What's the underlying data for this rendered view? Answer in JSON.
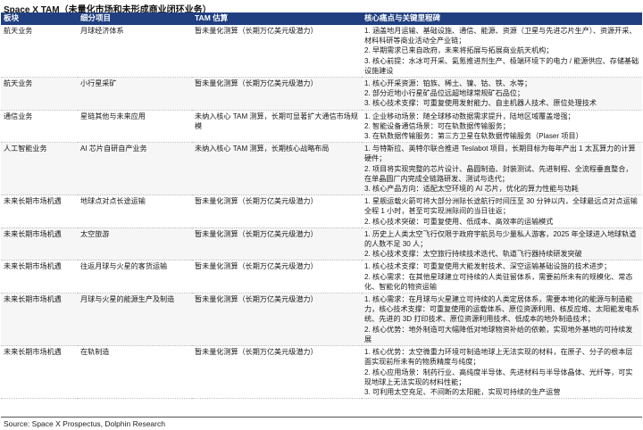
{
  "title": "Space X TAM（未量化市场和未形成商业闭环业务）",
  "headers": [
    "板块",
    "细分项目",
    "TAM 估算",
    "核心痛点与关键里程碑"
  ],
  "rows": [
    {
      "sector": "航天业务",
      "item": "月球经济体系",
      "tam": "暂未量化测算（长期万亿美元级潜力）",
      "milestones": [
        "1. 涵盖地月运输、基础设施、通信、能源、资源（卫星与先进芯片生产）、资源开采、材料科研等商业活动全产业链；",
        "2. 早期需求已来自政府，未来将拓展与拓展商业航天机构；",
        "3. 核心前提：水冰可开采、氦氪推进剂生产、极端环境下的电力 / 能源供应、存储基础设施建设"
      ]
    },
    {
      "sector": "航天业务",
      "item": "小行星采矿",
      "tam": "暂未量化测算（长期万亿美元级潜力）",
      "milestones": [
        "1. 核心开采资源：铂族、稀土、镍、钴、铁、水等；",
        "2. 部分近地小行星矿品位远超地球常规矿石品位；",
        "3. 核心技术支撑：可重复使用发射能力、自主机器人技术、原位处理技术"
      ]
    },
    {
      "sector": "通信业务",
      "item": "星链其他与未来应用",
      "tam": "未纳入核心 TAM 测算，长期可显著扩大通信市场规模",
      "milestones": [
        "1. 企业移动场景：随全球移动数据需求提升，陆地区域覆盖增强；",
        "2. 智能设备通信场景：可在轨数据传输服务；",
        "3. 在轨数据传输服务：第三方卫星在轨数据传输服务（Plaser 项目）"
      ]
    },
    {
      "sector": "人工智能业务",
      "item": "AI 芯片自研自产业务",
      "tam": "未纳入核心 TAM 测算，长期核心战略布局",
      "milestones": [
        "1. 与特斯拉、英特尔联合推进 Teslabot 项目，长期目标为每年产出 1 太瓦算力的计算硬件；",
        "2. 项目将实现完整的芯片设计、晶圆制造、封装测试、先进制程、全流程垂直整合，在单晶圆厂内完成全链路研发、测试与迭代；",
        "3. 核心产品方向：适配太空环境的 AI 芯片，优化的算力性能与功耗"
      ]
    },
    {
      "sector": "未来长期市场机遇",
      "item": "地球点对点长途运输",
      "tam": "暂未量化测算（长期万亿美元级潜力）",
      "milestones": [
        "1. 星舰运载火箭可将大部分洲际长途航行时间压至 30 分钟以内，全球最远点对点运输全程 1 小时，甚至可实现洲际间的当日往返；",
        "2. 核心技术突破：可重复使用、低成本、高效率的运输模式"
      ]
    },
    {
      "sector": "未来长期市场机遇",
      "item": "太空旅游",
      "tam": "暂未量化测算（长期万亿美元级潜力）",
      "milestones": [
        "1. 历史上人类太空飞行仅限于政府宇航员与少量私人游客，2025 年全球进入地球轨道的人数不足 30 人；",
        "2. 核心技术支撑：太空旅行持续技术迭代、轨道飞行器持续研发突破"
      ]
    },
    {
      "sector": "未来长期市场机遇",
      "item": "往返月球与火星的客货运输",
      "tam": "暂未量化测算（长期万亿美元级潜力）",
      "milestones": [
        "1. 核心技术支撑：可重复使用大能发射技术、深空运输基础设施的技术进步；",
        "2. 核心需求：在其他星球建立可持续的人类驻留体系，需要前所未有的规模化、常态化、智能化的物资运输"
      ]
    },
    {
      "sector": "未来长期市场机遇",
      "item": "月球与火星的能源生产及制造",
      "tam": "暂未量化测算（长期万亿美元级潜力）",
      "milestones": [
        "1. 核心需求：在月球与火星建立可持续的人类定居体系，需要本地化的能源与制造能力，核心技术支撑：可重复使用的运载体系、原位资源利用、核反应堆、太阳能发电系统、先进的 3D 打印技术、原位资源利用技术、低成本的地外制造技术；",
        "2. 核心优势：地外制造可大幅降低对地球物资补给的依赖，实现地外基地的可持续发展"
      ]
    },
    {
      "sector": "未来长期市场机遇",
      "item": "在轨制造",
      "tam": "暂未量化测算（长期万亿美元级潜力）",
      "milestones": [
        "1. 核心优势：太空微重力环境可制造地球上无法实现的材料，在原子、分子的根本层面实现前所未有的物质精度与纯度；",
        "2. 核心应用场景：制药行业、高纯度半导体、先进材料与半导体晶体、光纤等，可实现地球上无法实现的材料性能；",
        "3. 可利用太空充足、不间断的太阳能，实现可持续的生产运营"
      ]
    }
  ],
  "source": "Source: Space X Prospectus, Dolphin Research"
}
